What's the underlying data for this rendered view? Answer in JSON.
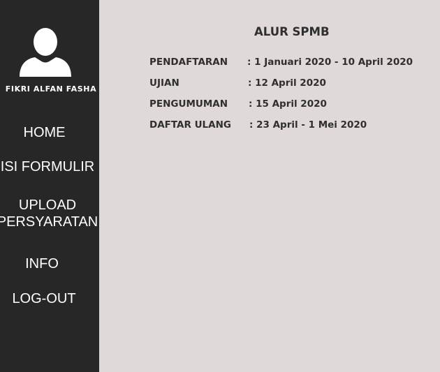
{
  "sidebar": {
    "user_name": "FIKRI ALFAN FASHA",
    "nav": {
      "home": "HOME",
      "isi_formulir": "ISI FORMULIR",
      "upload_line1": "UPLOAD",
      "upload_line2": "PERSYARATAN",
      "info": "INFO",
      "logout": "LOG-OUT"
    },
    "background_color": "#272727",
    "avatar_icon": "user-silhouette-icon"
  },
  "main": {
    "title": "ALUR SPMB",
    "schedule": [
      {
        "label": "PENDAFTARAN",
        "value": ": 1 Januari 2020 - 10 April 2020"
      },
      {
        "label": "UJIAN",
        "value": ": 12 April 2020"
      },
      {
        "label": "PENGUMUMAN",
        "value": ": 15 April 2020"
      },
      {
        "label": "DAFTAR ULANG",
        "value": ": 23 April - 1 Mei 2020"
      }
    ],
    "background_color": "#dfd9d9",
    "text_color": "#2f2f2f"
  }
}
